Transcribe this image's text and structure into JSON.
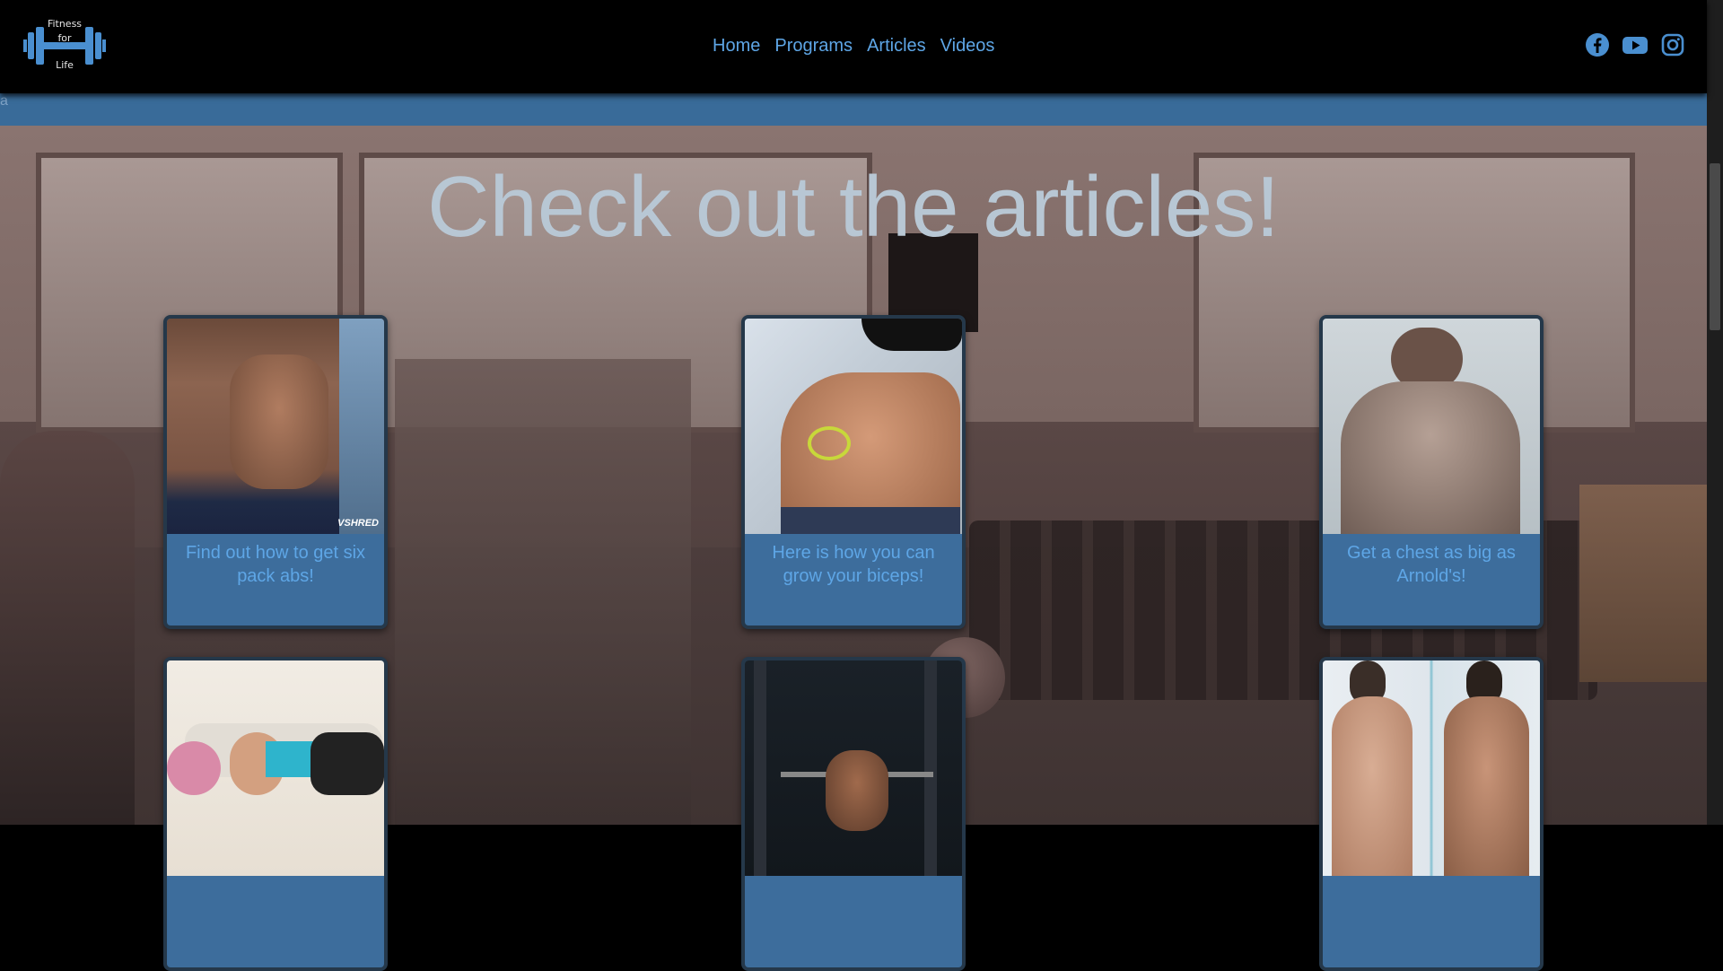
{
  "logo": {
    "line1": "Fitness",
    "line2": "for",
    "line3": "Life",
    "icon": "dumbbell-icon"
  },
  "nav": {
    "items": [
      "Home",
      "Programs",
      "Articles",
      "Videos"
    ]
  },
  "socials": [
    "facebook-icon",
    "youtube-icon",
    "instagram-icon"
  ],
  "strip": {
    "text": "a"
  },
  "hero": {
    "title": "Check out the articles!"
  },
  "cards": [
    {
      "caption": "Find out how to get six pack abs!",
      "badge": "VSHRED"
    },
    {
      "caption": "Here is how you can grow your biceps!"
    },
    {
      "caption": "Get a chest as big as Arnold's!"
    },
    {
      "caption": ""
    },
    {
      "caption": ""
    },
    {
      "caption": ""
    }
  ],
  "colors": {
    "accent": "#5ea6e6",
    "strip": "#396b99",
    "card": "#3d6d9c",
    "title": "#b8c7d4"
  }
}
